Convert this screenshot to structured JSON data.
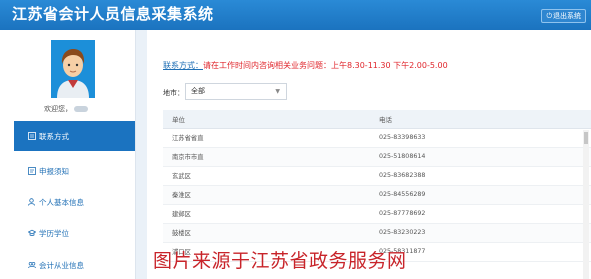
{
  "header": {
    "title": "江苏省会计人员信息采集系统",
    "logout_label": "退出系统"
  },
  "sidebar": {
    "welcome": "欢迎您，",
    "items": [
      {
        "label": "联系方式",
        "icon": "contact-card-icon",
        "active": true
      },
      {
        "label": "申报须知",
        "icon": "notice-icon",
        "active": false
      },
      {
        "label": "个人基本信息",
        "icon": "person-edit-icon",
        "active": false
      },
      {
        "label": "学历学位",
        "icon": "graduation-cap-icon",
        "active": false
      },
      {
        "label": "会计从业信息",
        "icon": "group-icon",
        "active": false
      }
    ]
  },
  "main": {
    "contact_label": "联系方式：",
    "contact_text": "请在工作时间内咨询相关业务问题：上午8.30-11.30 下午2.00-5.00",
    "region_label": "地市：",
    "region_value": "全部",
    "table": {
      "headers": [
        "单位",
        "电话"
      ],
      "rows": [
        [
          "江苏省省直",
          "025-83398633"
        ],
        [
          "南京市市直",
          "025-51808614"
        ],
        [
          "玄武区",
          "025-83682388"
        ],
        [
          "秦淮区",
          "025-84556289"
        ],
        [
          "建邺区",
          "025-87778692"
        ],
        [
          "鼓楼区",
          "025-83230223"
        ],
        [
          "浦口区",
          "025-58311877"
        ]
      ]
    }
  },
  "watermark": "图片来源于江苏省政务服务网"
}
